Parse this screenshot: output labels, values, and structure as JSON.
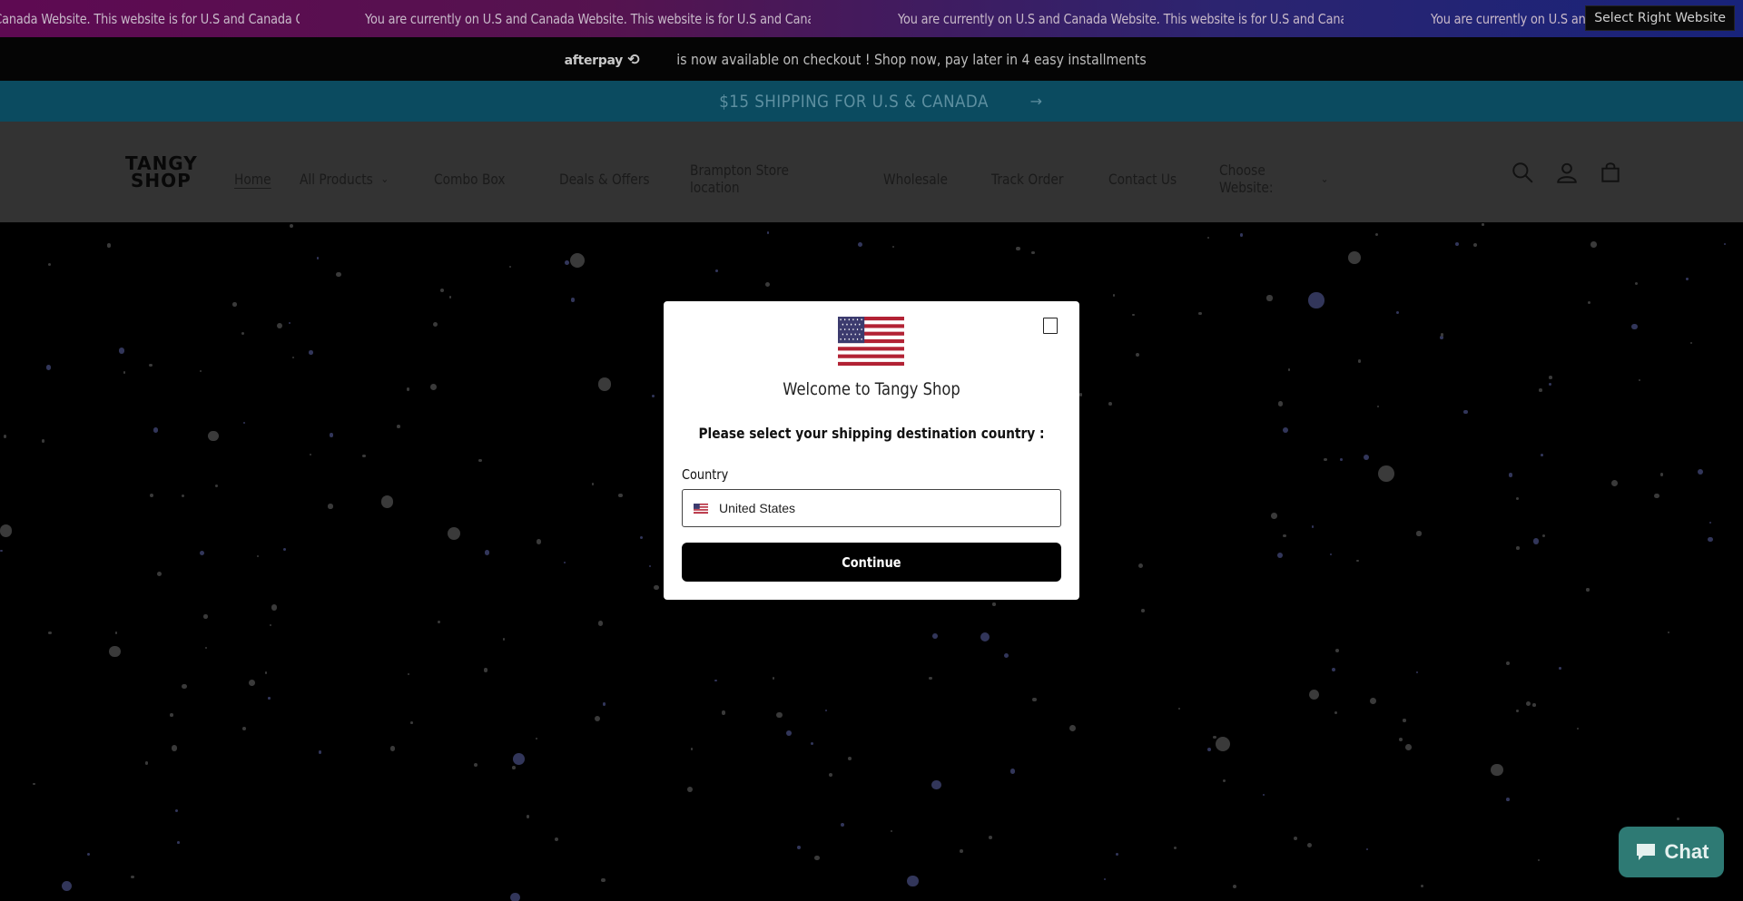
{
  "marquee": {
    "items": [
      "You are currently on U.S and Canada Website. This website is for U.S and Canada Orders Only.",
      "You are currently on U.S and Canada Website. This website is for U.S and Canada Orders Only.",
      "You are currently on U.S and Canada Website. This website is for U.S and Canada Orders Only.",
      "You are currently on U.S and Canada"
    ],
    "first_visible": "l Canada Website. This website is for U.S and Canada Orders Only.",
    "button_label": "Select Right Website"
  },
  "afterpay": {
    "logo": "afterpay",
    "text": "is now available on checkout ! Shop now, pay later in 4 easy installments"
  },
  "shipping": {
    "text": "$15 SHIPPING FOR U.S & CANADA",
    "arrow": "→"
  },
  "header": {
    "logo_line1": "TANGY",
    "logo_line2": "SHOP",
    "nav": [
      {
        "label": "Home",
        "active": true,
        "dropdown": false
      },
      {
        "label": "All Products",
        "active": false,
        "dropdown": true
      },
      {
        "label": "Combo Box",
        "active": false,
        "dropdown": false
      },
      {
        "label": "Deals & Offers",
        "active": false,
        "dropdown": false
      },
      {
        "label": "Brampton Store location",
        "active": false,
        "dropdown": false
      },
      {
        "label": "Wholesale",
        "active": false,
        "dropdown": false
      },
      {
        "label": "Track Order",
        "active": false,
        "dropdown": false
      },
      {
        "label": "Contact Us",
        "active": false,
        "dropdown": false
      },
      {
        "label": "Choose Website:",
        "active": false,
        "dropdown": true
      }
    ],
    "icons": [
      "search-icon",
      "account-icon",
      "cart-icon"
    ]
  },
  "modal": {
    "title": "Welcome to Tangy Shop",
    "subtitle": "Please select your shipping destination country :",
    "country_label": "Country",
    "country_value": "United States",
    "continue_label": "Continue"
  },
  "chat": {
    "label": "Chat"
  },
  "colors": {
    "marquee_start": "#5e0a52",
    "marquee_end": "#18237a",
    "shipping_bar": "#0b4b60",
    "chat_button": "#2e7a74"
  }
}
